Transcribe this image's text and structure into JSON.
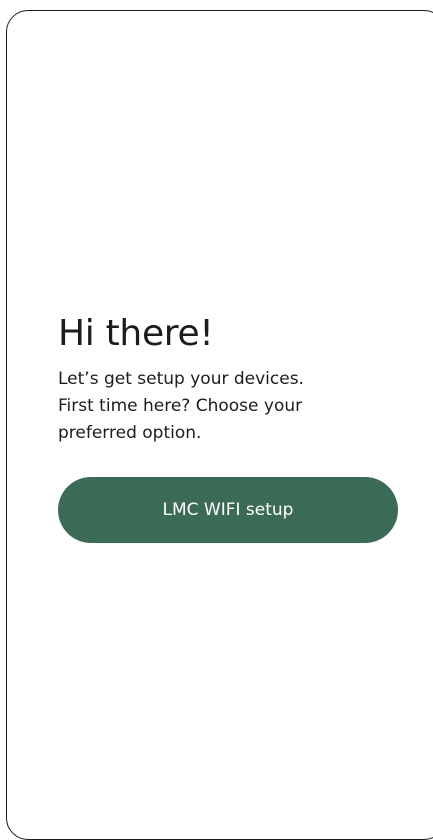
{
  "welcome": {
    "title": "Hi there!",
    "subtitle": "Let’s get setup your devices.\nFirst time here? Choose your\npreferred option."
  },
  "actions": {
    "wifi_setup_label": "LMC WIFI setup"
  },
  "colors": {
    "accent": "#3b6b57",
    "text": "#1c1c1c",
    "background": "#ffffff"
  }
}
